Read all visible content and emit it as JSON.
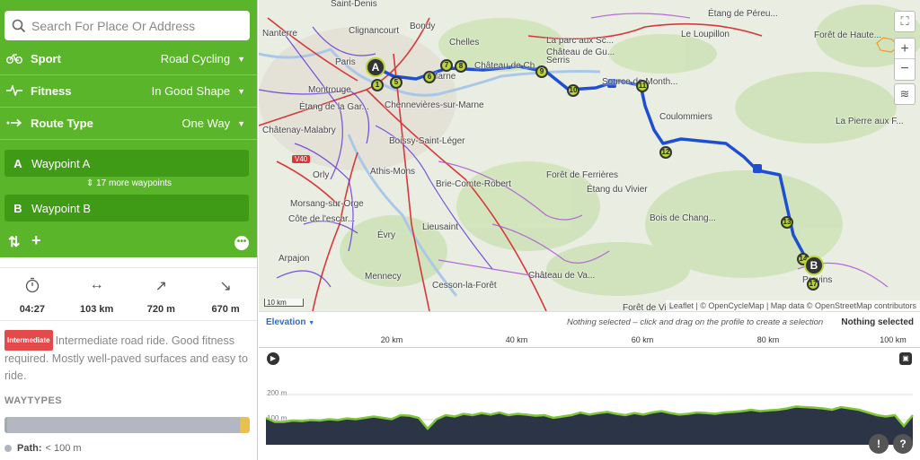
{
  "search": {
    "placeholder": "Search For Place Or Address"
  },
  "settings": [
    {
      "icon": "bike-icon",
      "label": "Sport",
      "value": "Road Cycling"
    },
    {
      "icon": "pulse-icon",
      "label": "Fitness",
      "value": "In Good Shape"
    },
    {
      "icon": "route-type-icon",
      "label": "Route Type",
      "value": "One Way"
    }
  ],
  "waypoints": {
    "a": {
      "letter": "A",
      "label": "Waypoint A"
    },
    "more": "17 more waypoints",
    "b": {
      "letter": "B",
      "label": "Waypoint B"
    }
  },
  "stats": [
    {
      "icon": "stopwatch-icon",
      "value": "04:27"
    },
    {
      "icon": "distance-icon",
      "value": "103 km"
    },
    {
      "icon": "ascent-icon",
      "value": "720 m"
    },
    {
      "icon": "descent-icon",
      "value": "670 m"
    }
  ],
  "description": {
    "badge": "Intermediate",
    "text": "Intermediate road ride. Good fitness required. Mostly well-paved surfaces and easy to ride."
  },
  "waytypes": {
    "title": "WAYTYPES",
    "segments": [
      {
        "color": "#9bb0a8",
        "fraction": 0.01
      },
      {
        "color": "#b4b7c2",
        "fraction": 0.95
      },
      {
        "color": "#e8c04c",
        "fraction": 0.04
      }
    ],
    "path_label": "Path:",
    "path_value": "< 100 m"
  },
  "map": {
    "places": [
      "Saint-Denis",
      "Nanterre",
      "Clignancourt",
      "Bondy",
      "Chelles",
      "Étang de Péreu...",
      "Forêt de Haute...",
      "Le Loupillon",
      "La parc aux Sc...",
      "Château de Gu...",
      "Château de Ch...",
      "Serris",
      "Marne",
      "Paris",
      "Montrouge",
      "Étang de la Gar...",
      "Chennevières-sur-Marne",
      "Coulommiers",
      "La Pierre aux F...",
      "Châtenay-Malabry",
      "Boissy-Saint-Léger",
      "Athis-Mons",
      "Brie-Comte-Robert",
      "Étang du Vivier",
      "Morsang-sur-Orge",
      "Côte de l'escar...",
      "Évry",
      "Lieusaint",
      "Bois de Chang...",
      "Arpajon",
      "Mennecy",
      "Château de Va...",
      "Cesson-la-Forêt",
      "Provins",
      "Forêt de Ville",
      "Source de Month...",
      "Forêt de Ferrières",
      "Orly"
    ],
    "road_label": "V40",
    "scale": "10 km",
    "attribution": "Leaflet | © OpenCycleMap | Map data © OpenStreetMap contributors",
    "markers": [
      "A",
      "1",
      "5",
      "6",
      "7",
      "8",
      "9",
      "10",
      "11",
      "12",
      "13",
      "14",
      "B",
      "17"
    ]
  },
  "elevation": {
    "title": "Elevation",
    "note": "Nothing selected – click and drag on the profile to create a selection",
    "selected": "Nothing selected",
    "ticks": [
      "20 km",
      "40 km",
      "60 km",
      "80 km",
      "100 km"
    ],
    "y_labels": [
      "200 m",
      "100 m"
    ],
    "profile_m": [
      100,
      85,
      85,
      90,
      88,
      92,
      90,
      95,
      92,
      98,
      95,
      100,
      105,
      100,
      95,
      110,
      108,
      100,
      60,
      95,
      110,
      105,
      115,
      110,
      118,
      112,
      120,
      110,
      115,
      112,
      108,
      110,
      100,
      105,
      110,
      120,
      112,
      118,
      122,
      115,
      110,
      118,
      112,
      120,
      125,
      118,
      112,
      115,
      120,
      118,
      115,
      120,
      122,
      125,
      130,
      125,
      128,
      130,
      135,
      142,
      140,
      138,
      135,
      130,
      140,
      135,
      130,
      120,
      110,
      105,
      110,
      70,
      110
    ]
  }
}
